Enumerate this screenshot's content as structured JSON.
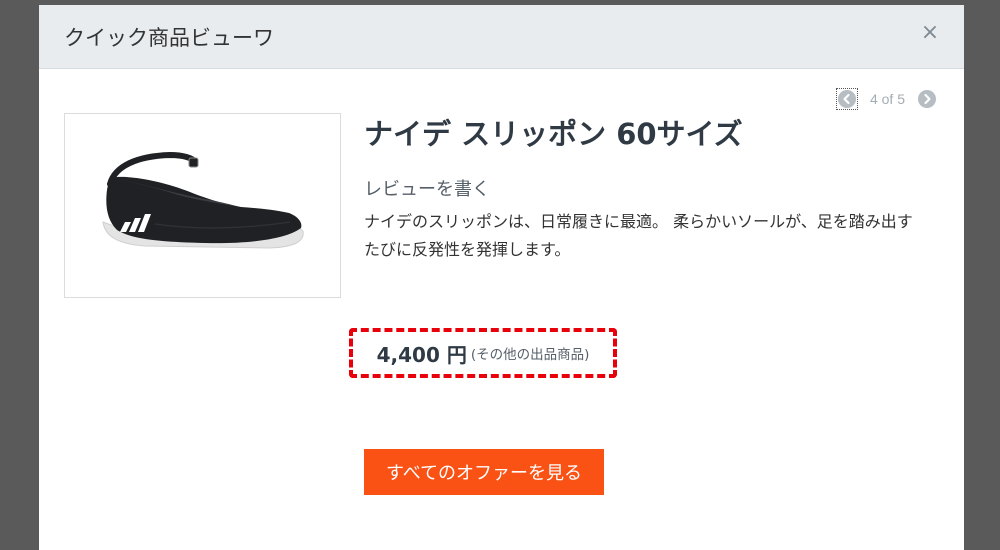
{
  "modal": {
    "title": "クイック商品ビューワ",
    "close_label": "×"
  },
  "pager": {
    "label": "4 of 5",
    "prev_icon": "chevron-left-circle-icon",
    "next_icon": "chevron-right-circle-icon"
  },
  "product": {
    "name": "ナイデ スリッポン 60サイズ",
    "review_link": "レビューを書く",
    "description": "ナイデのスリッポンは、日常履きに最適。 柔らかいソールが、足を踏み出すたびに反発性を発揮します。",
    "price": "4,400 円",
    "other_sellers": "(その他の出品商品)",
    "image": "black-slip-on-shoe"
  },
  "actions": {
    "view_offers": "すべてのオファーを見る"
  },
  "colors": {
    "accent_button": "#fa5115",
    "price_highlight_border": "#e8000b",
    "header_background": "#e8ecef"
  }
}
